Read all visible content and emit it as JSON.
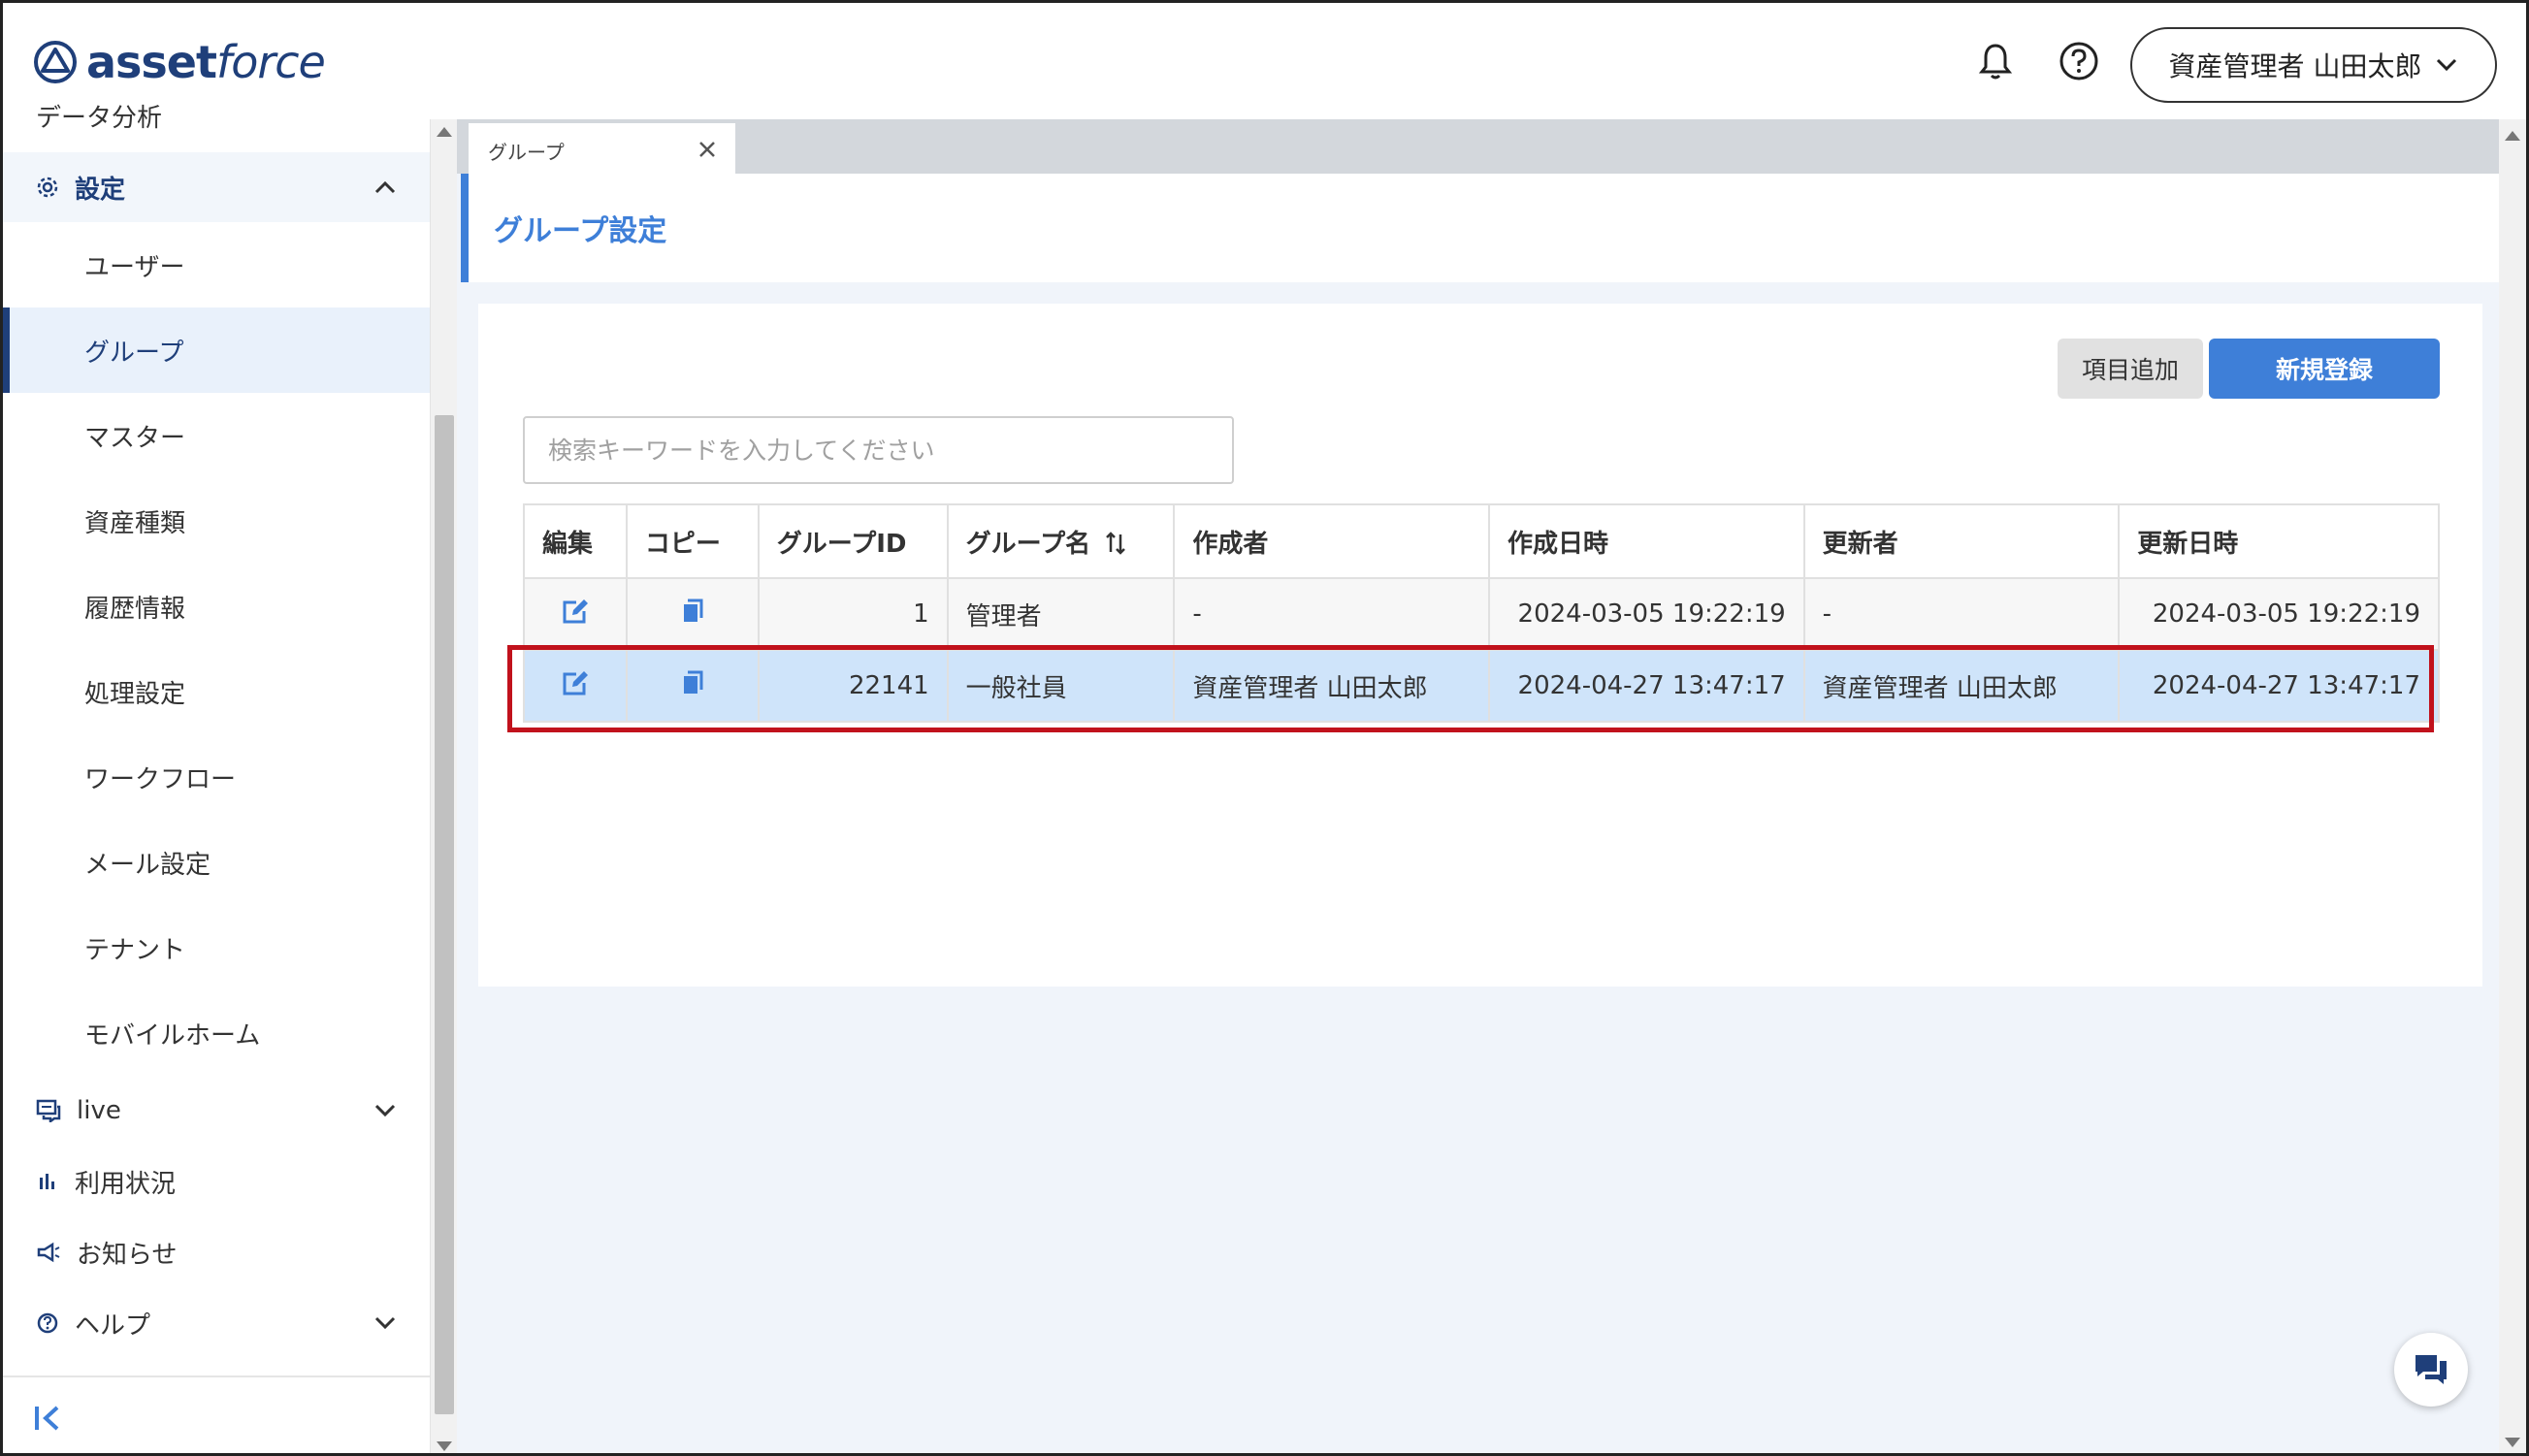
{
  "header": {
    "logo_bold": "asset",
    "logo_italic": "force",
    "user_label": "資産管理者 山田太郎",
    "bell_icon": "bell-icon",
    "help_icon": "help-circle-icon"
  },
  "sidebar": {
    "cut_item": "データ分析",
    "settings_label": "設定",
    "sub_items": [
      "ユーザー",
      "グループ",
      "マスター",
      "資産種類",
      "履歴情報",
      "処理設定",
      "ワークフロー",
      "メール設定",
      "テナント",
      "モバイルホーム"
    ],
    "active_item": "グループ",
    "live_label": "live",
    "usage_label": "利用状況",
    "notice_label": "お知らせ",
    "help_label": "ヘルプ"
  },
  "tab": {
    "label": "グループ"
  },
  "page": {
    "title": "グループ設定",
    "add_field_button": "項目追加",
    "new_button": "新規登録",
    "search_placeholder": "検索キーワードを入力してください"
  },
  "table": {
    "headers": [
      "編集",
      "コピー",
      "グループID",
      "グループ名",
      "作成者",
      "作成日時",
      "更新者",
      "更新日時"
    ],
    "rows": [
      {
        "id": "1",
        "name": "管理者",
        "creator": "-",
        "created": "2024-03-05 19:22:19",
        "updater": "-",
        "updated": "2024-03-05 19:22:19"
      },
      {
        "id": "22141",
        "name": "一般社員",
        "creator": "資産管理者 山田太郎",
        "created": "2024-04-27 13:47:17",
        "updater": "資産管理者 山田太郎",
        "updated": "2024-04-27 13:47:17"
      }
    ],
    "selected_row": 1
  },
  "colors": {
    "brand": "#1f3f7a",
    "accent": "#3e7fd8",
    "selected_row": "#cfe4fa",
    "highlight_border": "#c1121c"
  }
}
